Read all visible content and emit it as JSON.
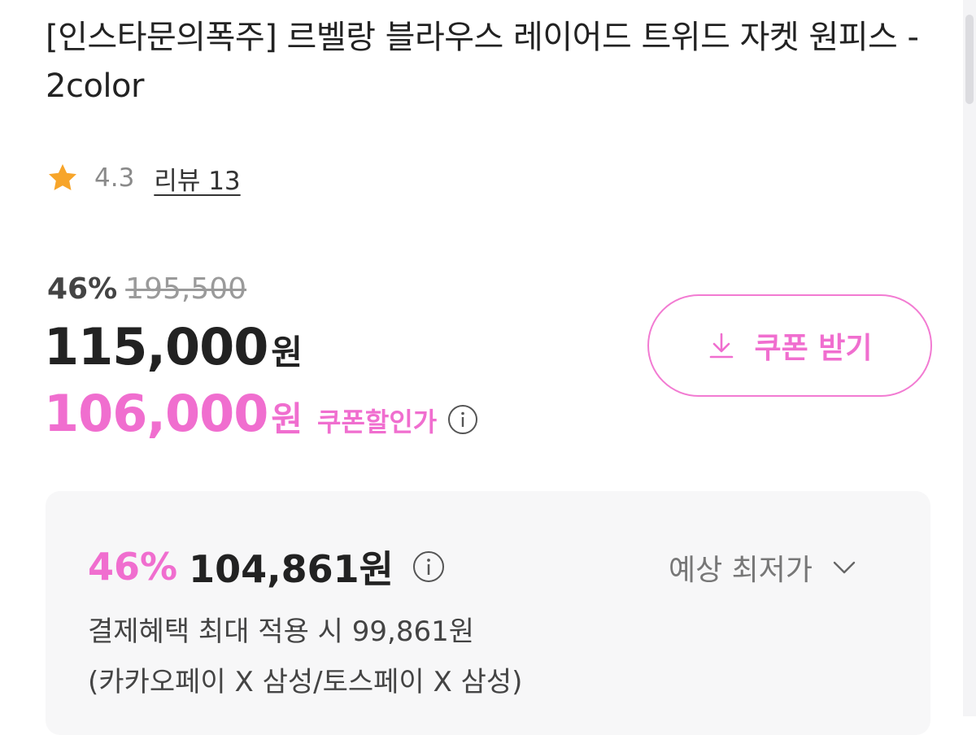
{
  "product": {
    "title": "[인스타문의폭주] 르벨랑 블라우스 레이어드 트위드 자켓 원피스 - 2color",
    "rating": "4.3",
    "review_label": "리뷰 13"
  },
  "pricing": {
    "discount_rate": "46%",
    "original_price": "195,500",
    "sale_price": "115,000",
    "sale_unit": "원",
    "coupon_price": "106,000",
    "coupon_unit": "원",
    "coupon_label": "쿠폰할인가",
    "coupon_button_label": "쿠폰 받기"
  },
  "benefit": {
    "rate": "46%",
    "price": "104,861원",
    "lowest_label": "예상 최저가",
    "line1": "결제혜택 최대 적용 시 99,861원",
    "line2": "(카카오페이 X 삼성/토스페이 X 삼성)"
  },
  "colors": {
    "accent_pink": "#f06ecf",
    "star_orange": "#f7a52a",
    "benefit_bg": "#f7f7f8"
  },
  "icons": {
    "rating": "star-icon",
    "coupon_button": "download-icon",
    "coupon_info": "info-icon",
    "benefit_info": "info-icon",
    "lowest_toggle": "chevron-down-icon"
  }
}
